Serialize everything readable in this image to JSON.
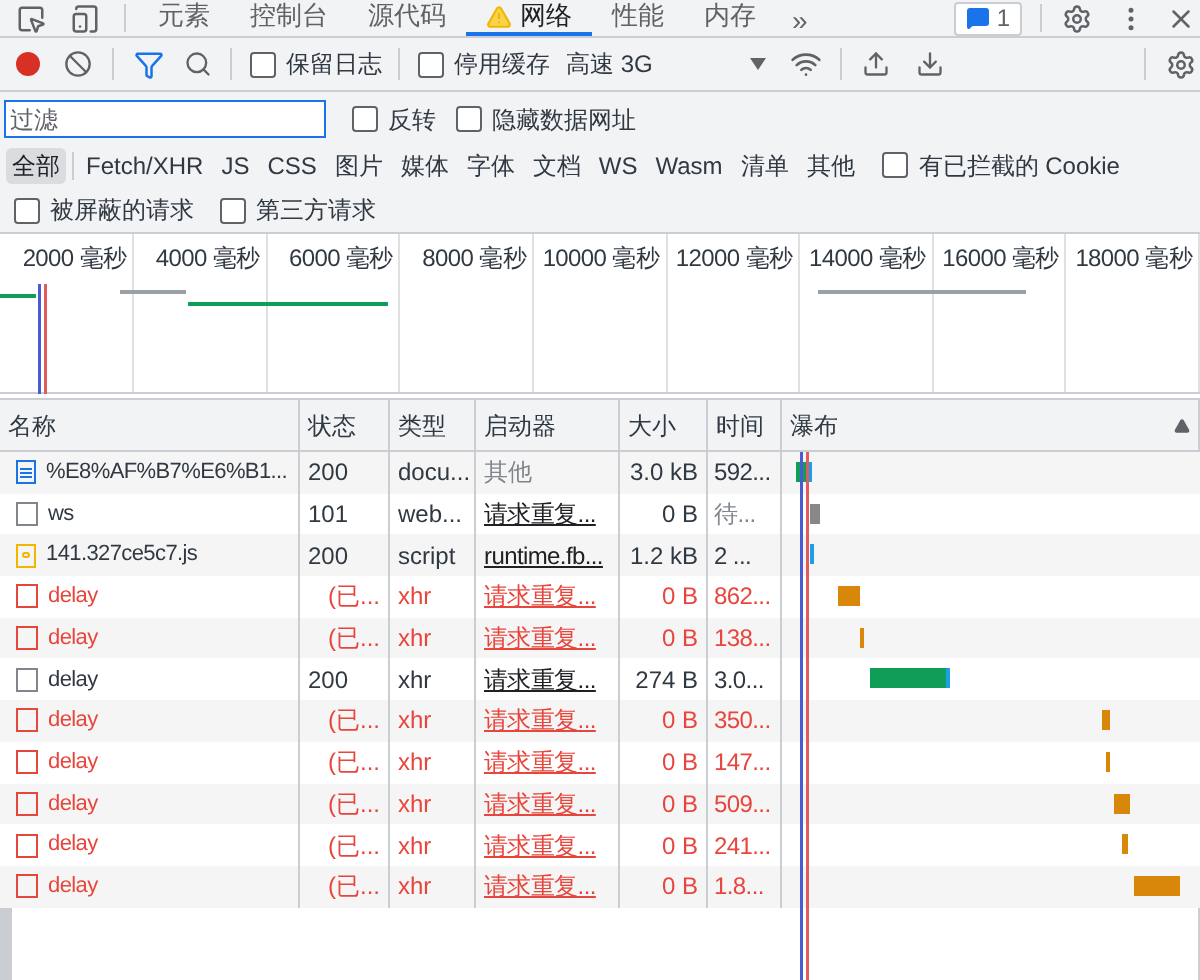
{
  "top_tabs": [
    {
      "label": "元素",
      "selected": false,
      "warning": false
    },
    {
      "label": "控制台",
      "selected": false,
      "warning": false
    },
    {
      "label": "源代码",
      "selected": false,
      "warning": false
    },
    {
      "label": "网络",
      "selected": true,
      "warning": true
    },
    {
      "label": "性能",
      "selected": false,
      "warning": false
    },
    {
      "label": "内存",
      "selected": false,
      "warning": false
    }
  ],
  "more_tabs": "»",
  "issues_badge": "1",
  "toolbar": {
    "recording": true,
    "filter_active": true,
    "checkboxes": [
      {
        "label": "保留日志",
        "checked": false
      },
      {
        "label": "停用缓存",
        "checked": false
      }
    ],
    "throttling": "高速 3G"
  },
  "filter": {
    "placeholder": "过滤",
    "checkboxes": [
      {
        "label": "反转",
        "checked": false
      },
      {
        "label": "隐藏数据网址",
        "checked": false
      }
    ]
  },
  "type_filters": [
    {
      "label": "全部",
      "selected": true
    },
    {
      "label": "Fetch/XHR",
      "selected": false
    },
    {
      "label": "JS",
      "selected": false
    },
    {
      "label": "CSS",
      "selected": false
    },
    {
      "label": "图片",
      "selected": false
    },
    {
      "label": "媒体",
      "selected": false
    },
    {
      "label": "字体",
      "selected": false
    },
    {
      "label": "文档",
      "selected": false
    },
    {
      "label": "WS",
      "selected": false
    },
    {
      "label": "Wasm",
      "selected": false
    },
    {
      "label": "清单",
      "selected": false
    },
    {
      "label": "其他",
      "selected": false
    }
  ],
  "blocked_cookies": {
    "label": "有已拦截的 Cookie",
    "checked": false
  },
  "request_filters": [
    {
      "label": "被屏蔽的请求",
      "checked": false
    },
    {
      "label": "第三方请求",
      "checked": false
    }
  ],
  "overview_ticks": [
    "2000 毫秒",
    "4000 毫秒",
    "6000 毫秒",
    "8000 毫秒",
    "10000 毫秒",
    "12000 毫秒",
    "14000 毫秒",
    "16000 毫秒",
    "18000 毫秒"
  ],
  "table": {
    "columns": [
      "名称",
      "状态",
      "类型",
      "启动器",
      "大小",
      "时间",
      "瀑布"
    ],
    "rows": [
      {
        "kind": "document",
        "failed": false,
        "name": "%E8%AF%B7%E6%B1...",
        "status": "200",
        "type": "docu...",
        "initiator": "其他",
        "initiator_link": false,
        "size": "3.0 kB",
        "time": "592..."
      },
      {
        "kind": "websocket",
        "failed": false,
        "name": "ws",
        "status": "101",
        "type": "web...",
        "initiator": "请求重复...",
        "initiator_link": true,
        "size": "0 B",
        "time": "待..."
      },
      {
        "kind": "script",
        "failed": false,
        "name": "141.327ce5c7.js",
        "status": "200",
        "type": "script",
        "initiator": "runtime.fb...",
        "initiator_link": true,
        "size": "1.2 kB",
        "time": "2 ..."
      },
      {
        "kind": "xhr",
        "failed": true,
        "name": "delay",
        "status": "(已...",
        "type": "xhr",
        "initiator": "请求重复...",
        "initiator_link": true,
        "size": "0 B",
        "time": "862..."
      },
      {
        "kind": "xhr",
        "failed": true,
        "name": "delay",
        "status": "(已...",
        "type": "xhr",
        "initiator": "请求重复...",
        "initiator_link": true,
        "size": "0 B",
        "time": "138..."
      },
      {
        "kind": "xhr",
        "failed": false,
        "name": "delay",
        "status": "200",
        "type": "xhr",
        "initiator": "请求重复...",
        "initiator_link": true,
        "size": "274 B",
        "time": "3.0..."
      },
      {
        "kind": "xhr",
        "failed": true,
        "name": "delay",
        "status": "(已...",
        "type": "xhr",
        "initiator": "请求重复...",
        "initiator_link": true,
        "size": "0 B",
        "time": "350..."
      },
      {
        "kind": "xhr",
        "failed": true,
        "name": "delay",
        "status": "(已...",
        "type": "xhr",
        "initiator": "请求重复...",
        "initiator_link": true,
        "size": "0 B",
        "time": "147..."
      },
      {
        "kind": "xhr",
        "failed": true,
        "name": "delay",
        "status": "(已...",
        "type": "xhr",
        "initiator": "请求重复...",
        "initiator_link": true,
        "size": "0 B",
        "time": "509..."
      },
      {
        "kind": "xhr",
        "failed": true,
        "name": "delay",
        "status": "(已...",
        "type": "xhr",
        "initiator": "请求重复...",
        "initiator_link": true,
        "size": "0 B",
        "time": "241..."
      },
      {
        "kind": "xhr",
        "failed": true,
        "name": "delay",
        "status": "(已...",
        "type": "xhr",
        "initiator": "请求重复...",
        "initiator_link": true,
        "size": "0 B",
        "time": "1.8..."
      }
    ]
  }
}
